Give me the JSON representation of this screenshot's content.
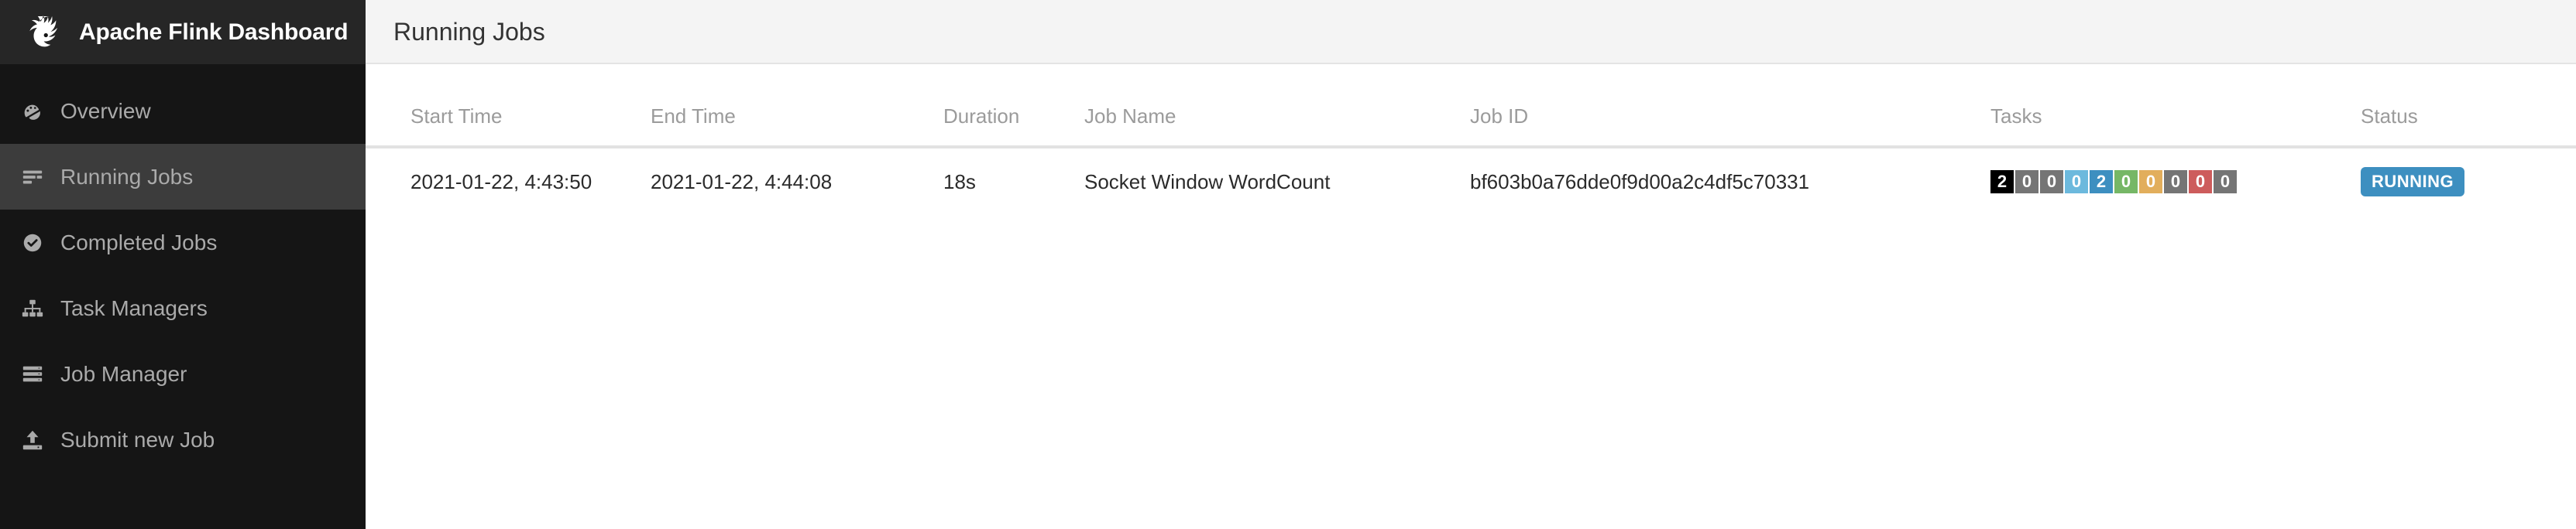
{
  "brand": {
    "title": "Apache Flink Dashboard",
    "logo_icon": "flink-squirrel-logo"
  },
  "sidebar": {
    "items": [
      {
        "label": "Overview",
        "icon": "dashboard-gauge-icon",
        "active": false
      },
      {
        "label": "Running Jobs",
        "icon": "list-lines-icon",
        "active": true
      },
      {
        "label": "Completed Jobs",
        "icon": "check-circle-icon",
        "active": false
      },
      {
        "label": "Task Managers",
        "icon": "sitemap-icon",
        "active": false
      },
      {
        "label": "Job Manager",
        "icon": "server-stack-icon",
        "active": false
      },
      {
        "label": "Submit new Job",
        "icon": "upload-icon",
        "active": false
      }
    ]
  },
  "page": {
    "title": "Running Jobs"
  },
  "table": {
    "columns": [
      "Start Time",
      "End Time",
      "Duration",
      "Job Name",
      "Job ID",
      "Tasks",
      "Status"
    ],
    "rows": [
      {
        "start_time": "2021-01-22, 4:43:50",
        "end_time": "2021-01-22, 4:44:08",
        "duration": "18s",
        "job_name": "Socket Window WordCount",
        "job_id": "bf603b0a76dde0f9d00a2c4df5c70331",
        "tasks": [
          {
            "value": "2",
            "color": "#000000"
          },
          {
            "value": "0",
            "color": "#757575"
          },
          {
            "value": "0",
            "color": "#757575"
          },
          {
            "value": "0",
            "color": "#6cb9dd"
          },
          {
            "value": "2",
            "color": "#3d8fc0"
          },
          {
            "value": "0",
            "color": "#76b766"
          },
          {
            "value": "0",
            "color": "#e2ae5c"
          },
          {
            "value": "0",
            "color": "#757575"
          },
          {
            "value": "0",
            "color": "#cd5c5c"
          },
          {
            "value": "0",
            "color": "#757575"
          }
        ],
        "status": "RUNNING",
        "status_color": "#3d8fc0"
      }
    ]
  },
  "colors": {
    "sidebar_bg": "#151515",
    "sidebar_brand_bg": "#262626",
    "sidebar_active_bg": "#3c3c3c",
    "sidebar_text": "#aaaaaa",
    "page_header_bg": "#f4f4f4",
    "accent": "#3d8fc0"
  }
}
